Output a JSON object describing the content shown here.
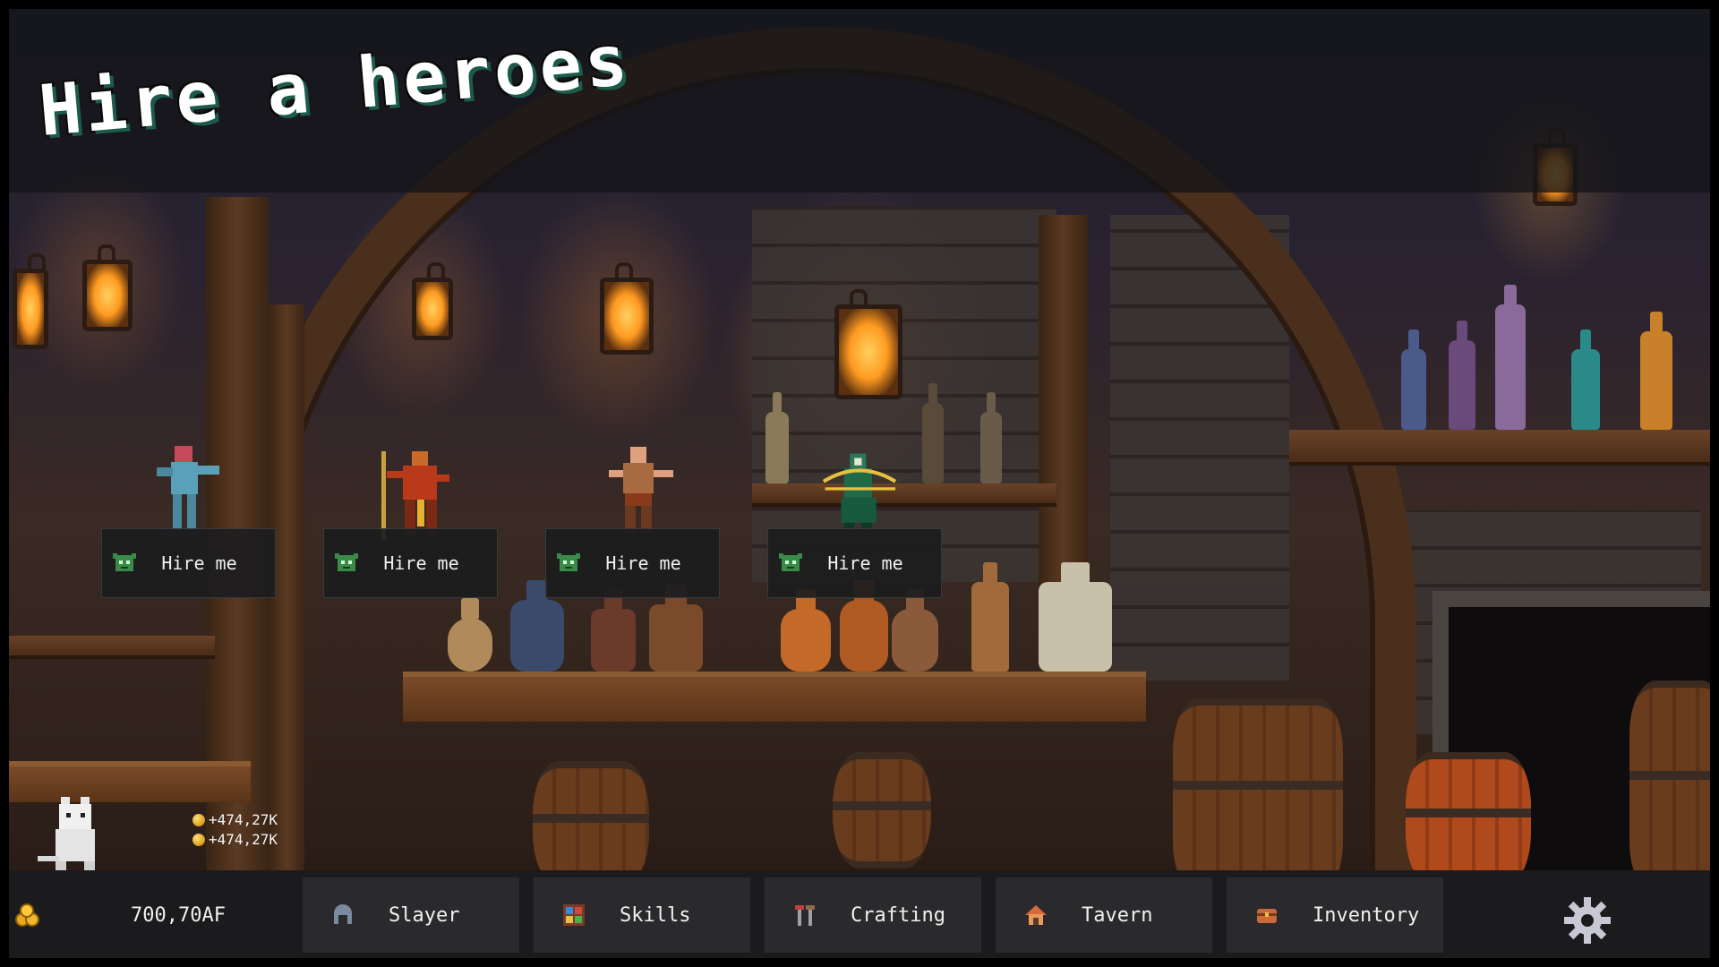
{
  "header": {
    "title": "Hire a heroes"
  },
  "heroes": [
    {
      "hire_label": "Hire me",
      "class_icon": "goblin-face-icon",
      "hero": "blue-armored-warrior"
    },
    {
      "hire_label": "Hire me",
      "class_icon": "goblin-face-icon",
      "hero": "red-spearman"
    },
    {
      "hire_label": "Hire me",
      "class_icon": "goblin-face-icon",
      "hero": "bald-brawler"
    },
    {
      "hire_label": "Hire me",
      "class_icon": "goblin-face-icon",
      "hero": "green-archer"
    }
  ],
  "income": {
    "line1": "+474,27K",
    "line2": "+474,27K"
  },
  "currency": {
    "value": "700,70AF",
    "icon": "gold-coins-icon"
  },
  "nav": [
    {
      "label": "Slayer",
      "icon": "helmet-icon"
    },
    {
      "label": "Skills",
      "icon": "skills-grid-icon"
    },
    {
      "label": "Crafting",
      "icon": "tools-icon"
    },
    {
      "label": "Tavern",
      "icon": "tavern-house-icon"
    },
    {
      "label": "Inventory",
      "icon": "chest-icon"
    }
  ],
  "settings": {
    "icon": "gear-icon"
  },
  "colors": {
    "accent": "#1c5a4a",
    "bar": "#1b1b1d",
    "button": "#2a2a2d",
    "gold": "#e8a818"
  }
}
